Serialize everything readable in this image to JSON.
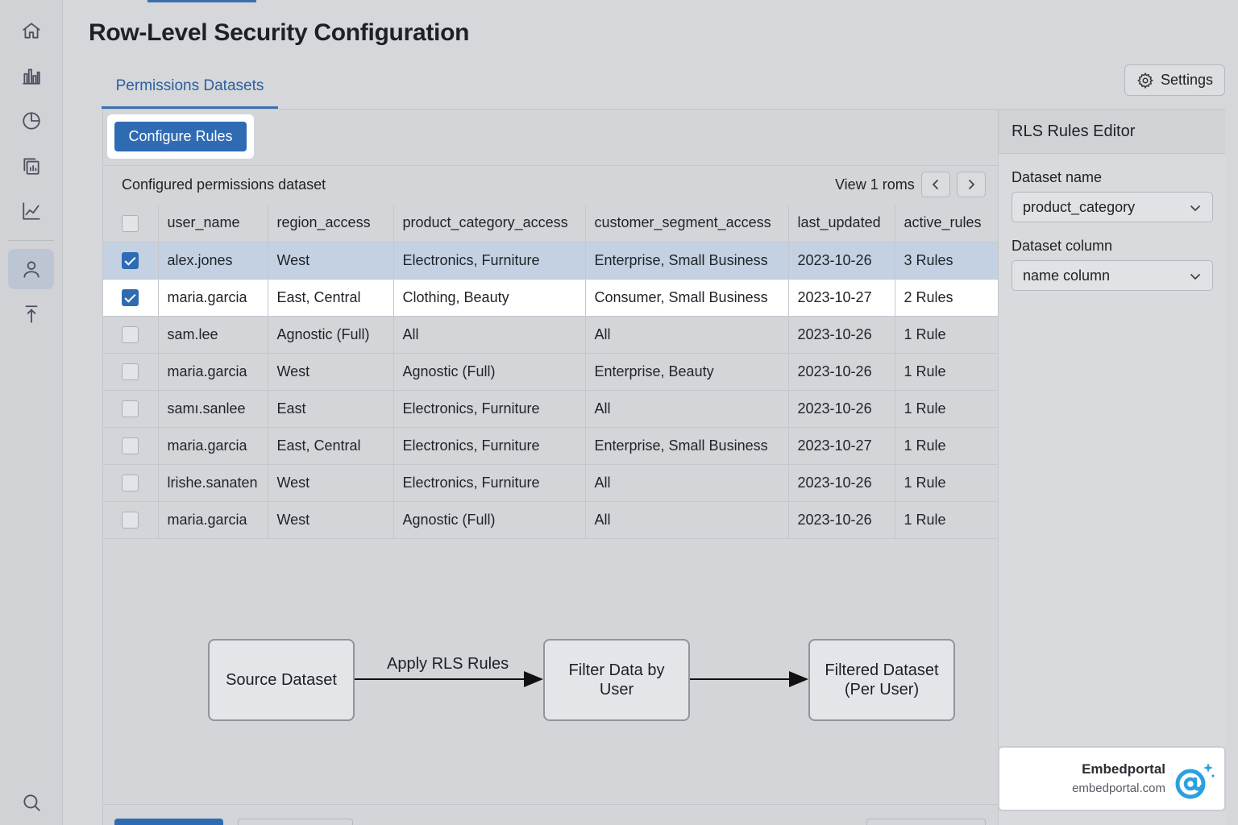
{
  "page": {
    "title": "Row-Level Security Configuration"
  },
  "nav": {
    "items": [
      {
        "name": "home-icon"
      },
      {
        "name": "bar-chart-icon"
      },
      {
        "name": "pie-chart-icon"
      },
      {
        "name": "copy-report-icon"
      },
      {
        "name": "line-chart-icon"
      },
      {
        "name": "user-icon",
        "active": true
      },
      {
        "name": "upload-icon"
      },
      {
        "name": "search-icon"
      }
    ]
  },
  "tabs": [
    {
      "label": "Permissions Datasets",
      "active": true
    }
  ],
  "header": {
    "settings_label": "Settings"
  },
  "toolbar": {
    "configure_label": "Configure Rules"
  },
  "dataset": {
    "caption": "Configured permissions dataset",
    "view_text": "View 1 roms",
    "columns": [
      "user_name",
      "region_access",
      "product_category_access",
      "customer_segment_access",
      "last_updated",
      "active_rules"
    ],
    "rows": [
      {
        "checked": true,
        "cells": [
          "alex.jones",
          "West",
          "Electronics, Furniture",
          "Enterprise, Small Business",
          "2023-10-26",
          "3 Rules"
        ]
      },
      {
        "checked": true,
        "cells": [
          "maria.garcia",
          "East, Central",
          "Clothing, Beauty",
          "Consumer, Small Business",
          "2023-10-27",
          "2 Rules"
        ]
      },
      {
        "checked": false,
        "cells": [
          "sam.lee",
          "Agnostic (Full)",
          "All",
          "All",
          "2023-10-26",
          "1 Rule"
        ]
      },
      {
        "checked": false,
        "cells": [
          "maria.garcia",
          "West",
          "Agnostic (Full)",
          "Enterprise, Beauty",
          "2023-10-26",
          "1 Rule"
        ]
      },
      {
        "checked": false,
        "cells": [
          "samı.sanlee",
          "East",
          "Electronics, Furniture",
          "All",
          "2023-10-26",
          "1 Rule"
        ]
      },
      {
        "checked": false,
        "cells": [
          "maria.garcia",
          "East, Central",
          "Electronics, Furniture",
          "Enterprise, Small Business",
          "2023-10-27",
          "1 Rule"
        ]
      },
      {
        "checked": false,
        "cells": [
          "lrishe.sanaten",
          "West",
          "Electronics, Furniture",
          "All",
          "2023-10-26",
          "1 Rule"
        ]
      },
      {
        "checked": false,
        "cells": [
          "maria.garcia",
          "West",
          "Agnostic (Full)",
          "All",
          "2023-10-26",
          "1 Rule"
        ]
      }
    ]
  },
  "flow": {
    "source": "Source Dataset",
    "apply_label": "Apply RLS Rules",
    "filter": "Filter Data by User",
    "result": "Filtered Dataset (Per User)"
  },
  "editor": {
    "title": "RLS Rules Editor",
    "dataset_name_label": "Dataset name",
    "dataset_name_value": "product_category",
    "dataset_column_label": "Dataset column",
    "dataset_column_value": "name column"
  },
  "brand": {
    "name": "Embedportal",
    "url": "embedportal.com",
    "accent": "#2aa0e0"
  },
  "colors": {
    "primary": "#2f6bb3",
    "selected_row": "#c4d1e2"
  }
}
